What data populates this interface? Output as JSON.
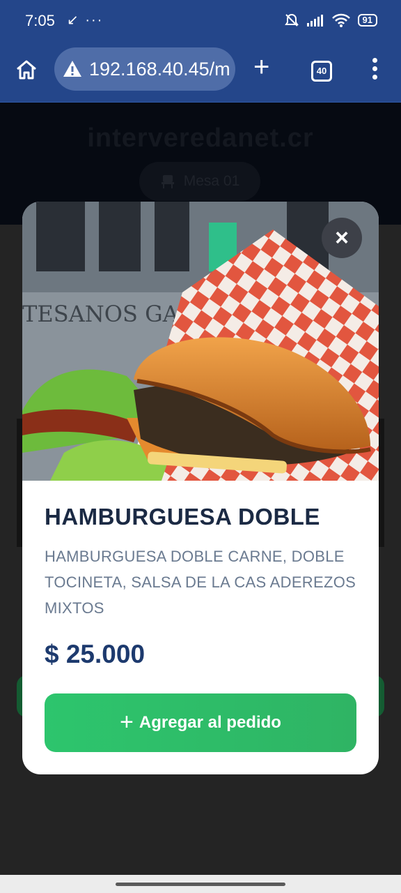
{
  "status_bar": {
    "time": "7:05",
    "extra": "↙ ···",
    "battery": "91"
  },
  "browser": {
    "url": "192.168.40.45/m",
    "tab_count": "40"
  },
  "page": {
    "site_name": "interveredanet.cr",
    "table_label": "Mesa 01"
  },
  "image": {
    "sign_text": "TESANOS  GA"
  },
  "modal": {
    "title": "HAMBURGUESA DOBLE",
    "description": "HAMBURGUESA DOBLE CARNE, DOBLE TOCINETA, SALSA DE LA CAS ADEREZOS MIXTOS",
    "price": "$ 25.000",
    "add_button_icon": "+",
    "add_button_label": "Agregar al pedido",
    "close_icon": "×"
  },
  "colors": {
    "toolbar": "#24468a",
    "title": "#1b2a44",
    "price": "#1d3a6e",
    "button": "#2dc56d"
  }
}
